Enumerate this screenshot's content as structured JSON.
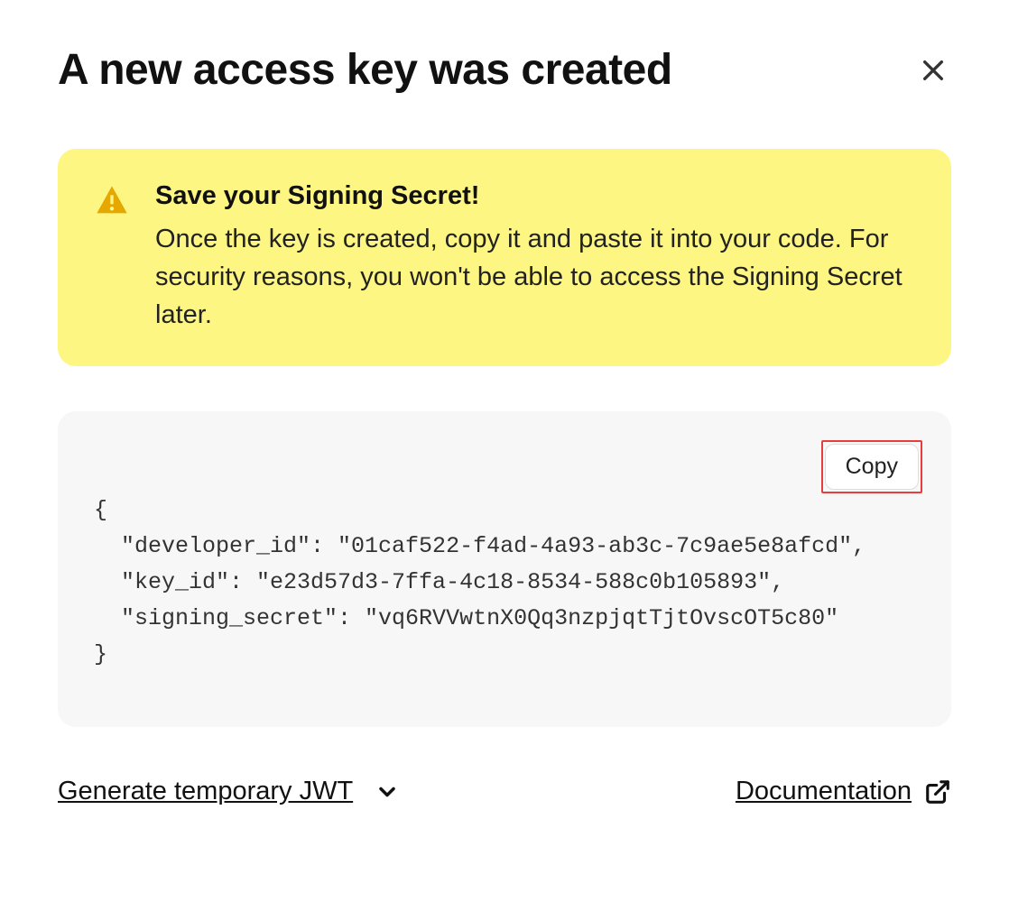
{
  "header": {
    "title": "A new access key was created"
  },
  "alert": {
    "title": "Save your Signing Secret!",
    "body": "Once the key is created, copy it and paste it into your code. For security reasons, you won't be able to access the Signing Secret later."
  },
  "code": {
    "copy_label": "Copy",
    "content": "{\n  \"developer_id\": \"01caf522-f4ad-4a93-ab3c-7c9ae5e8afcd\",\n  \"key_id\": \"e23d57d3-7ffa-4c18-8534-588c0b105893\",\n  \"signing_secret\": \"vq6RVVwtnX0Qq3nzpjqtTjtOvscOT5c80\"\n}"
  },
  "footer": {
    "jwt_label": "Generate temporary JWT",
    "doc_label": "Documentation"
  }
}
